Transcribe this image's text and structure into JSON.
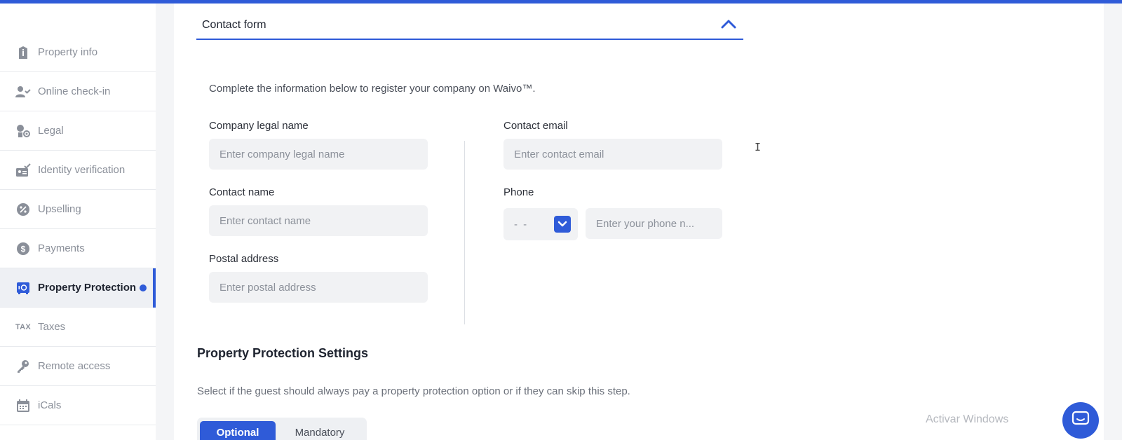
{
  "sidebar": {
    "items": [
      {
        "label": "Property info",
        "icon": "info-icon"
      },
      {
        "label": "Online check-in",
        "icon": "user-check-icon"
      },
      {
        "label": "Legal",
        "icon": "legal-icon"
      },
      {
        "label": "Identity verification",
        "icon": "id-card-icon"
      },
      {
        "label": "Upselling",
        "icon": "percent-badge-icon"
      },
      {
        "label": "Payments",
        "icon": "dollar-icon"
      },
      {
        "label": "Property Protection",
        "icon": "safe-icon",
        "active": true
      },
      {
        "label": "Taxes",
        "icon_text": "TAX"
      },
      {
        "label": "Remote access",
        "icon": "key-icon"
      },
      {
        "label": "iCals",
        "icon": "calendar-icon"
      }
    ]
  },
  "contact_form": {
    "title": "Contact form",
    "intro": "Complete the information below to register your company on Waivo™.",
    "company_legal_name": {
      "label": "Company legal name",
      "placeholder": "Enter company legal name"
    },
    "contact_name": {
      "label": "Contact name",
      "placeholder": "Enter contact name"
    },
    "postal_address": {
      "label": "Postal address",
      "placeholder": "Enter postal address"
    },
    "contact_email": {
      "label": "Contact email",
      "placeholder": "Enter contact email"
    },
    "phone": {
      "label": "Phone",
      "code_value": "- -",
      "placeholder": "Enter your phone n..."
    }
  },
  "protection_settings": {
    "title": "Property Protection Settings",
    "description": "Select if the guest should always pay a property protection option or if they can skip this step.",
    "options": [
      "Optional",
      "Mandatory"
    ],
    "selected": "Optional"
  },
  "overlay": {
    "watermark": "Activar Windows"
  },
  "colors": {
    "accent": "#2f5bd8",
    "active_bg": "#eef0f4",
    "input_bg": "#f1f2f4"
  }
}
